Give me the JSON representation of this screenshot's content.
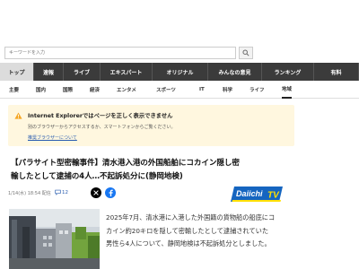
{
  "search": {
    "placeholder": "キーワードを入力",
    "value": ""
  },
  "main_nav": {
    "items": [
      {
        "label": "トップ",
        "active": true
      },
      {
        "label": "速報",
        "active": false
      },
      {
        "label": "ライブ",
        "active": false
      },
      {
        "label": "エキスパート",
        "active": false
      },
      {
        "label": "オリジナル",
        "active": false
      },
      {
        "label": "みんなの意見",
        "active": false
      },
      {
        "label": "ランキング",
        "active": false
      },
      {
        "label": "有料",
        "active": false
      }
    ]
  },
  "sub_nav": {
    "items": [
      {
        "label": "主要",
        "active": false
      },
      {
        "label": "国内",
        "active": false
      },
      {
        "label": "国際",
        "active": false
      },
      {
        "label": "経済",
        "active": false
      },
      {
        "label": "エンタメ",
        "active": false
      },
      {
        "label": "スポーツ",
        "active": false
      },
      {
        "label": "IT",
        "active": false
      },
      {
        "label": "科学",
        "active": false
      },
      {
        "label": "ライフ",
        "active": false
      },
      {
        "label": "地域",
        "active": true
      }
    ]
  },
  "notice": {
    "icon": "warning-icon",
    "title": "Internet Explorerではページを正しく表示できません",
    "body": "別のブラウザーからアクセスするか、スマートフォンからご覧ください。",
    "link": "推奨ブラウザーについて"
  },
  "article": {
    "headline_lines": [
      "【パラサイト型密輸事件】清水港入港の外国船舶にコカイン隠し密",
      "輸したとして逮捕の4人…不起訴処分に(静岡地検)"
    ],
    "date": "1/14(水) 18:54 配信",
    "comment_count": "12",
    "comment_icon": "comment-bubble-icon",
    "share_icons": [
      "x-logo-icon",
      "facebook-icon"
    ],
    "broadcaster_logo": "Daiichi TV",
    "body_lines": [
      "2025年7月、清水港に入港した外国籍の貨物船の船底にコ",
      "カイン約20キロを隠して密輸したとして逮捕されていた",
      "男性ら4人について、静岡地検は不起訴処分としました。"
    ]
  },
  "colors": {
    "nav_background": "#3b3b3b",
    "nav_active": "#dcdcdc",
    "notice_background": "#fff7df",
    "warning": "#f5a623",
    "link": "#2a5db0",
    "facebook": "#1877f2",
    "logo_blue": "#1565c0",
    "logo_yellow": "#ffe000"
  }
}
